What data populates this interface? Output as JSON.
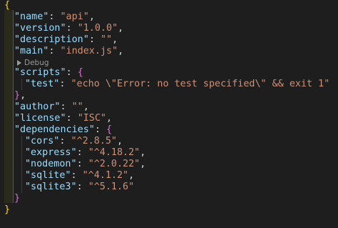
{
  "editor": {
    "language": "json",
    "colors": {
      "background": "#1e1e1e",
      "key": "#9cdcfe",
      "string": "#ce9178",
      "bracket_level_1": "#ffd700",
      "bracket_level_2": "#da70d6",
      "bracket_level_3": "#179fff"
    },
    "codelens": {
      "icon": "play-icon",
      "label": "Debug"
    },
    "lines": [
      {
        "tokens": [
          {
            "t": "brace1",
            "v": "{"
          }
        ]
      },
      {
        "tokens": [
          {
            "t": "key",
            "v": "\"name\""
          },
          {
            "t": "punc",
            "v": ": "
          },
          {
            "t": "str",
            "v": "\"api\""
          },
          {
            "t": "punc",
            "v": ","
          }
        ]
      },
      {
        "tokens": [
          {
            "t": "key",
            "v": "\"version\""
          },
          {
            "t": "punc",
            "v": ": "
          },
          {
            "t": "str",
            "v": "\"1.0.0\""
          },
          {
            "t": "punc",
            "v": ","
          }
        ]
      },
      {
        "tokens": [
          {
            "t": "key",
            "v": "\"description\""
          },
          {
            "t": "punc",
            "v": ": "
          },
          {
            "t": "str",
            "v": "\"\""
          },
          {
            "t": "punc",
            "v": ","
          }
        ]
      },
      {
        "tokens": [
          {
            "t": "key",
            "v": "\"main\""
          },
          {
            "t": "punc",
            "v": ": "
          },
          {
            "t": "str",
            "v": "\"index.js\""
          },
          {
            "t": "punc",
            "v": ","
          }
        ]
      },
      {
        "tokens": [
          {
            "t": "key",
            "v": "\"scripts\""
          },
          {
            "t": "punc",
            "v": ": "
          },
          {
            "t": "brace2",
            "v": "{"
          }
        ]
      },
      {
        "tokens": [
          {
            "t": "key",
            "v": "\"test\""
          },
          {
            "t": "punc",
            "v": ": "
          },
          {
            "t": "str",
            "v": "\"echo \\\"Error: no test specified\\\" && exit 1\""
          }
        ]
      },
      {
        "tokens": [
          {
            "t": "brace2",
            "v": "}"
          },
          {
            "t": "punc",
            "v": ","
          }
        ]
      },
      {
        "tokens": [
          {
            "t": "key",
            "v": "\"author\""
          },
          {
            "t": "punc",
            "v": ": "
          },
          {
            "t": "str",
            "v": "\"\""
          },
          {
            "t": "punc",
            "v": ","
          }
        ]
      },
      {
        "tokens": [
          {
            "t": "key",
            "v": "\"license\""
          },
          {
            "t": "punc",
            "v": ": "
          },
          {
            "t": "str",
            "v": "\"ISC\""
          },
          {
            "t": "punc",
            "v": ","
          }
        ]
      },
      {
        "tokens": [
          {
            "t": "key",
            "v": "\"dependencies\""
          },
          {
            "t": "punc",
            "v": ": "
          },
          {
            "t": "brace2",
            "v": "{"
          }
        ]
      },
      {
        "tokens": [
          {
            "t": "key",
            "v": "\"cors\""
          },
          {
            "t": "punc",
            "v": ": "
          },
          {
            "t": "str",
            "v": "\"^2.8.5\""
          },
          {
            "t": "punc",
            "v": ","
          }
        ]
      },
      {
        "tokens": [
          {
            "t": "key",
            "v": "\"express\""
          },
          {
            "t": "punc",
            "v": ": "
          },
          {
            "t": "str",
            "v": "\"^4.18.2\""
          },
          {
            "t": "punc",
            "v": ","
          }
        ]
      },
      {
        "tokens": [
          {
            "t": "key",
            "v": "\"nodemon\""
          },
          {
            "t": "punc",
            "v": ": "
          },
          {
            "t": "str",
            "v": "\"^2.0.22\""
          },
          {
            "t": "punc",
            "v": ","
          }
        ]
      },
      {
        "tokens": [
          {
            "t": "key",
            "v": "\"sqlite\""
          },
          {
            "t": "punc",
            "v": ": "
          },
          {
            "t": "str",
            "v": "\"^4.1.2\""
          },
          {
            "t": "punc",
            "v": ","
          }
        ]
      },
      {
        "tokens": [
          {
            "t": "key",
            "v": "\"sqlite3\""
          },
          {
            "t": "punc",
            "v": ": "
          },
          {
            "t": "str",
            "v": "\"^5.1.6\""
          }
        ]
      },
      {
        "tokens": [
          {
            "t": "brace2",
            "v": "}"
          }
        ]
      },
      {
        "tokens": [
          {
            "t": "brace1",
            "v": "}"
          }
        ]
      }
    ]
  }
}
